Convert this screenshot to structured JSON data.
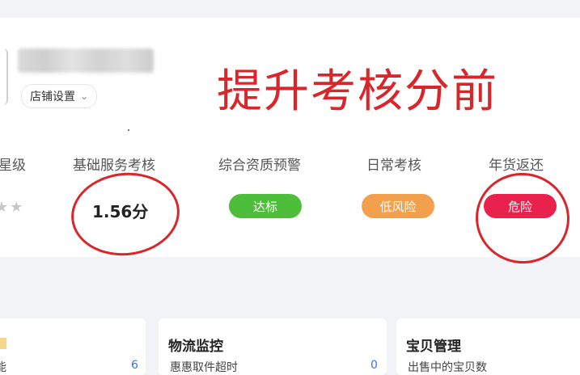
{
  "header": {
    "shop_settings_label": "店铺设置",
    "annotation": "提升考核分前"
  },
  "metrics": [
    {
      "label": "星级"
    },
    {
      "label": "基础服务考核",
      "value": "1.56分"
    },
    {
      "label": "综合资质预警",
      "badge": "达标",
      "badge_color": "#4cbe3a"
    },
    {
      "label": "日常考核",
      "badge": "低风险",
      "badge_color": "#f3a04c"
    },
    {
      "label": "年货返还",
      "badge": "危险",
      "badge_color": "#e8214d"
    }
  ],
  "panels": [
    {
      "title": "",
      "row_text": "能",
      "count": "6"
    },
    {
      "title": "物流监控",
      "row_text": "惠惠取件超时",
      "count": "0"
    },
    {
      "title": "宝贝管理",
      "row_text": "出售中的宝贝数",
      "count": ""
    }
  ],
  "colors": {
    "annotation_red": "#d8262b",
    "accent_yellow": "#f6b73c",
    "link_blue": "#3a6ff7"
  }
}
